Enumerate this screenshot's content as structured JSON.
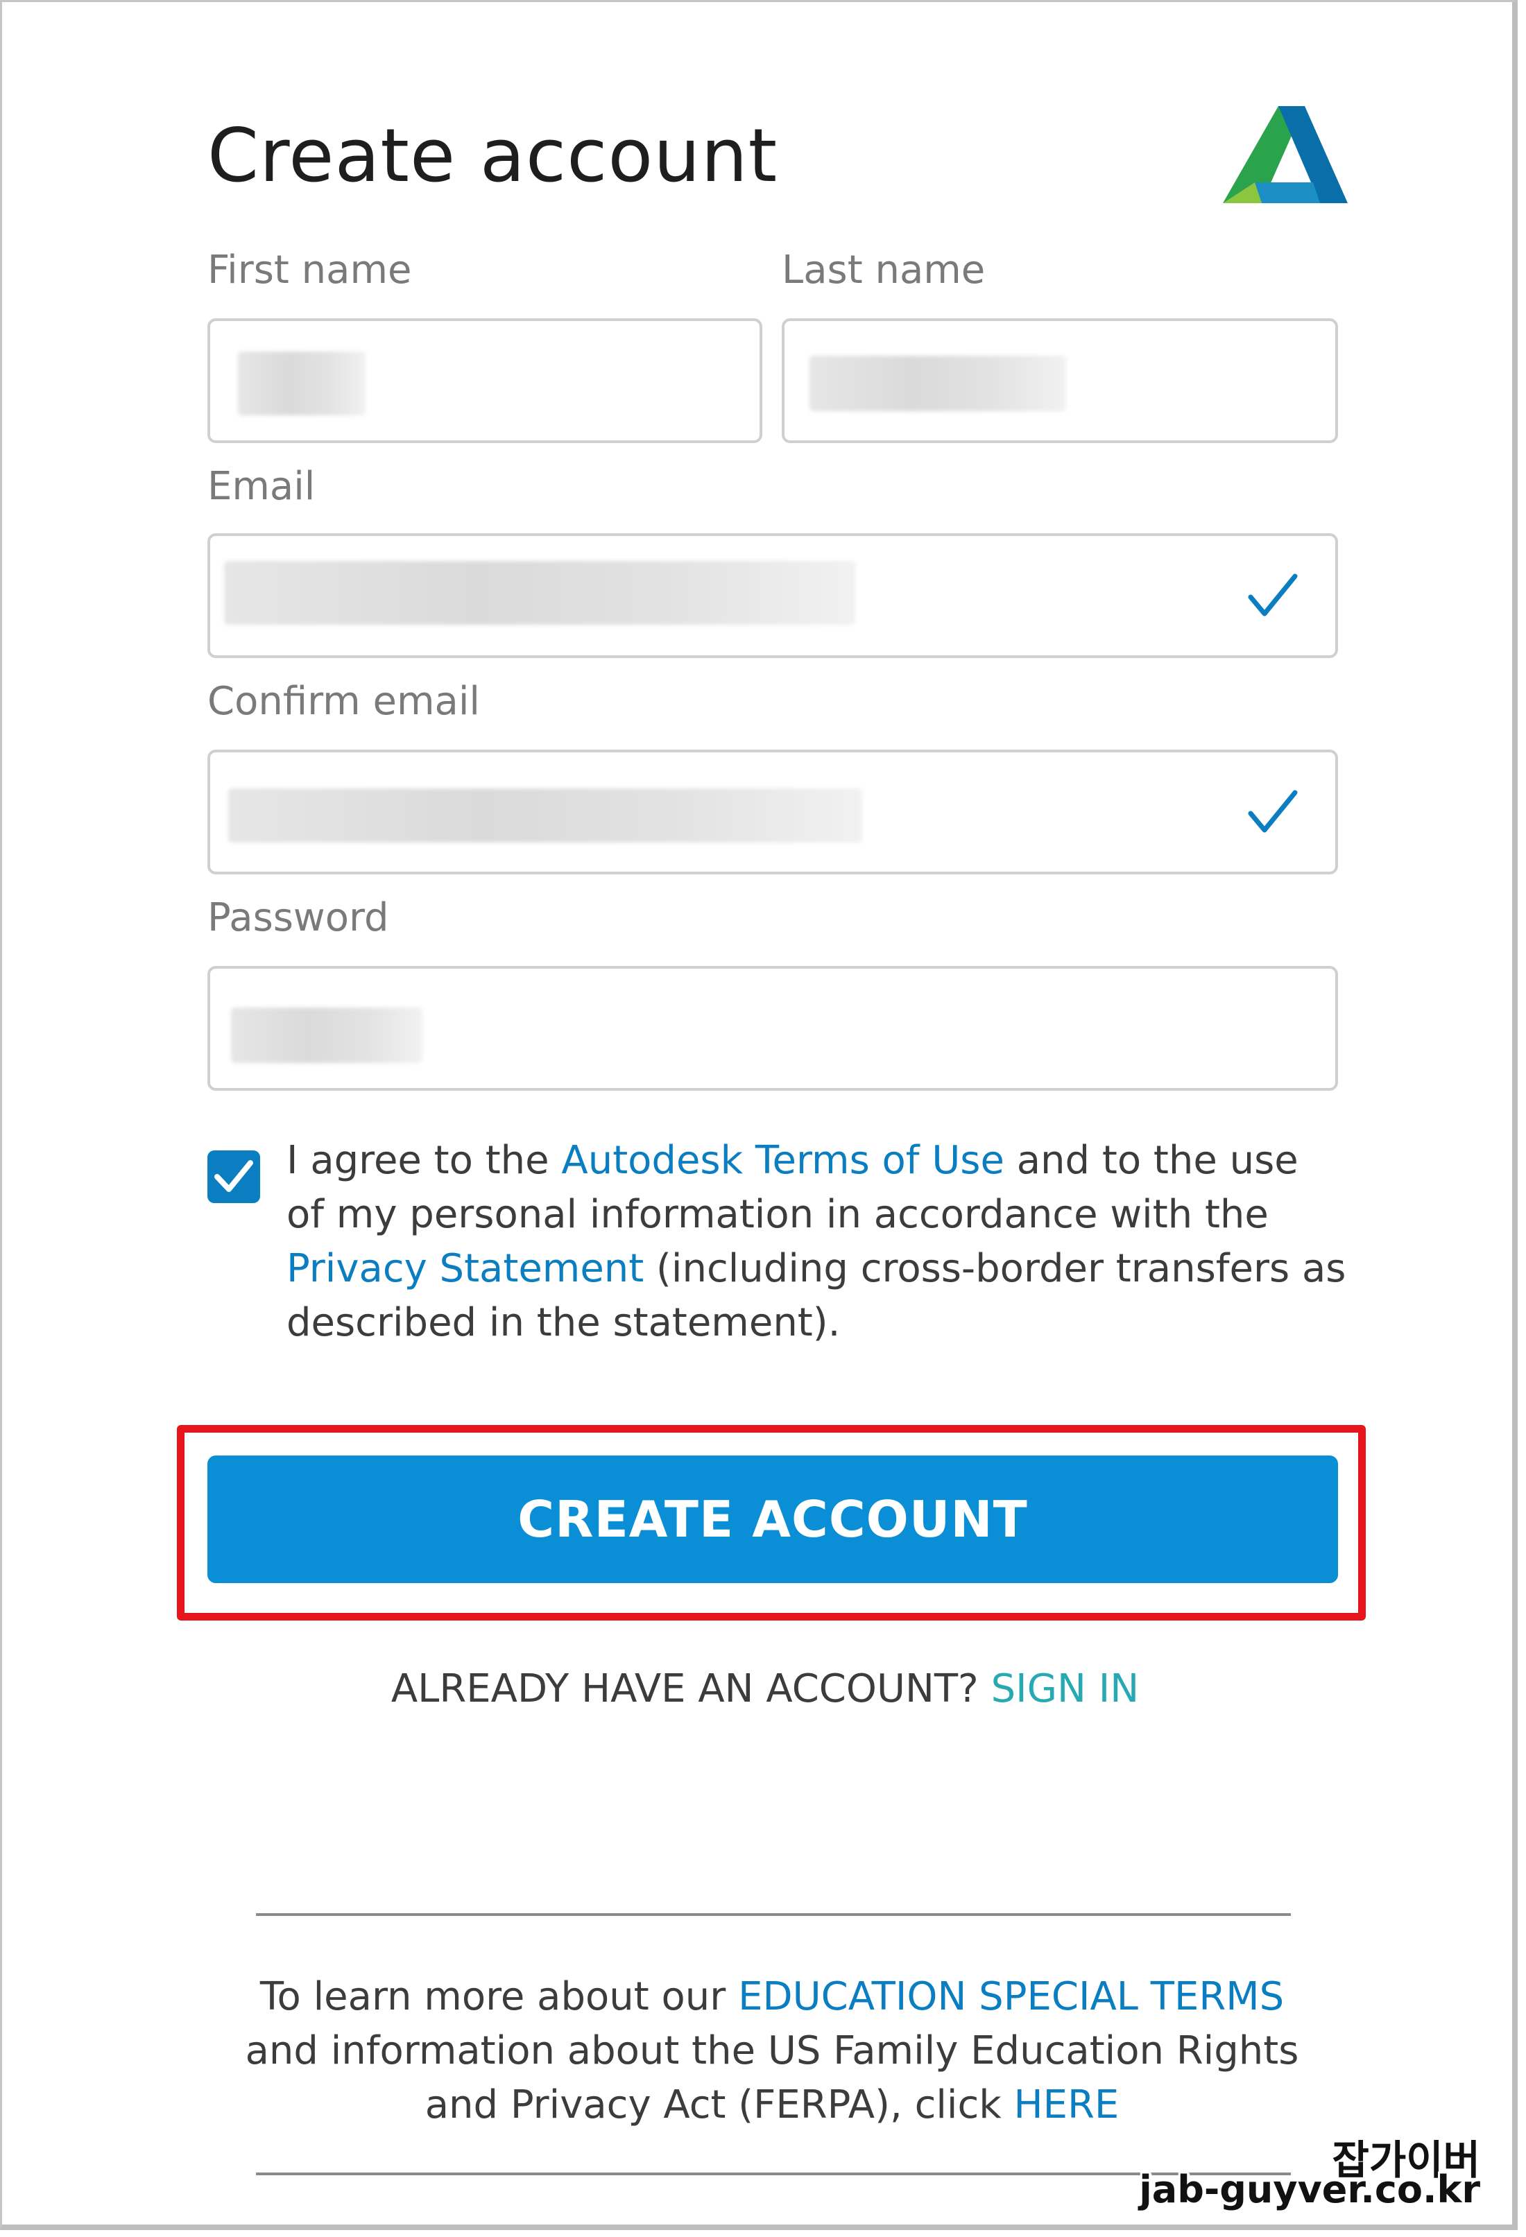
{
  "header": {
    "title": "Create account",
    "logo": "autodesk-logo"
  },
  "form": {
    "first_name_label": "First name",
    "last_name_label": "Last name",
    "email_label": "Email",
    "confirm_email_label": "Confirm email",
    "password_label": "Password"
  },
  "agreement": {
    "checked": true,
    "text_1": "I agree to the ",
    "terms_link": "Autodesk Terms of Use",
    "text_2": " and to the use of my personal information in accordance with the ",
    "privacy_link": "Privacy Statement",
    "text_3": " (including cross-border transfers as described in the statement)."
  },
  "cta": {
    "label": "CREATE ACCOUNT"
  },
  "signin": {
    "prompt": "ALREADY HAVE AN ACCOUNT? ",
    "link": "SIGN IN"
  },
  "education": {
    "text_1": "To learn more about our ",
    "terms_link": "EDUCATION SPECIAL TERMS",
    "text_2": " and information about the US Family Education Rights and Privacy Act (FERPA), click ",
    "here_link": "HERE"
  },
  "watermark": {
    "line1": "잡가이버",
    "line2": "jab-guyver.co.kr"
  },
  "colors": {
    "link": "#0b7ec1",
    "button": "#0a8fd6",
    "signin": "#27a9b3",
    "highlight": "#e8141b"
  }
}
